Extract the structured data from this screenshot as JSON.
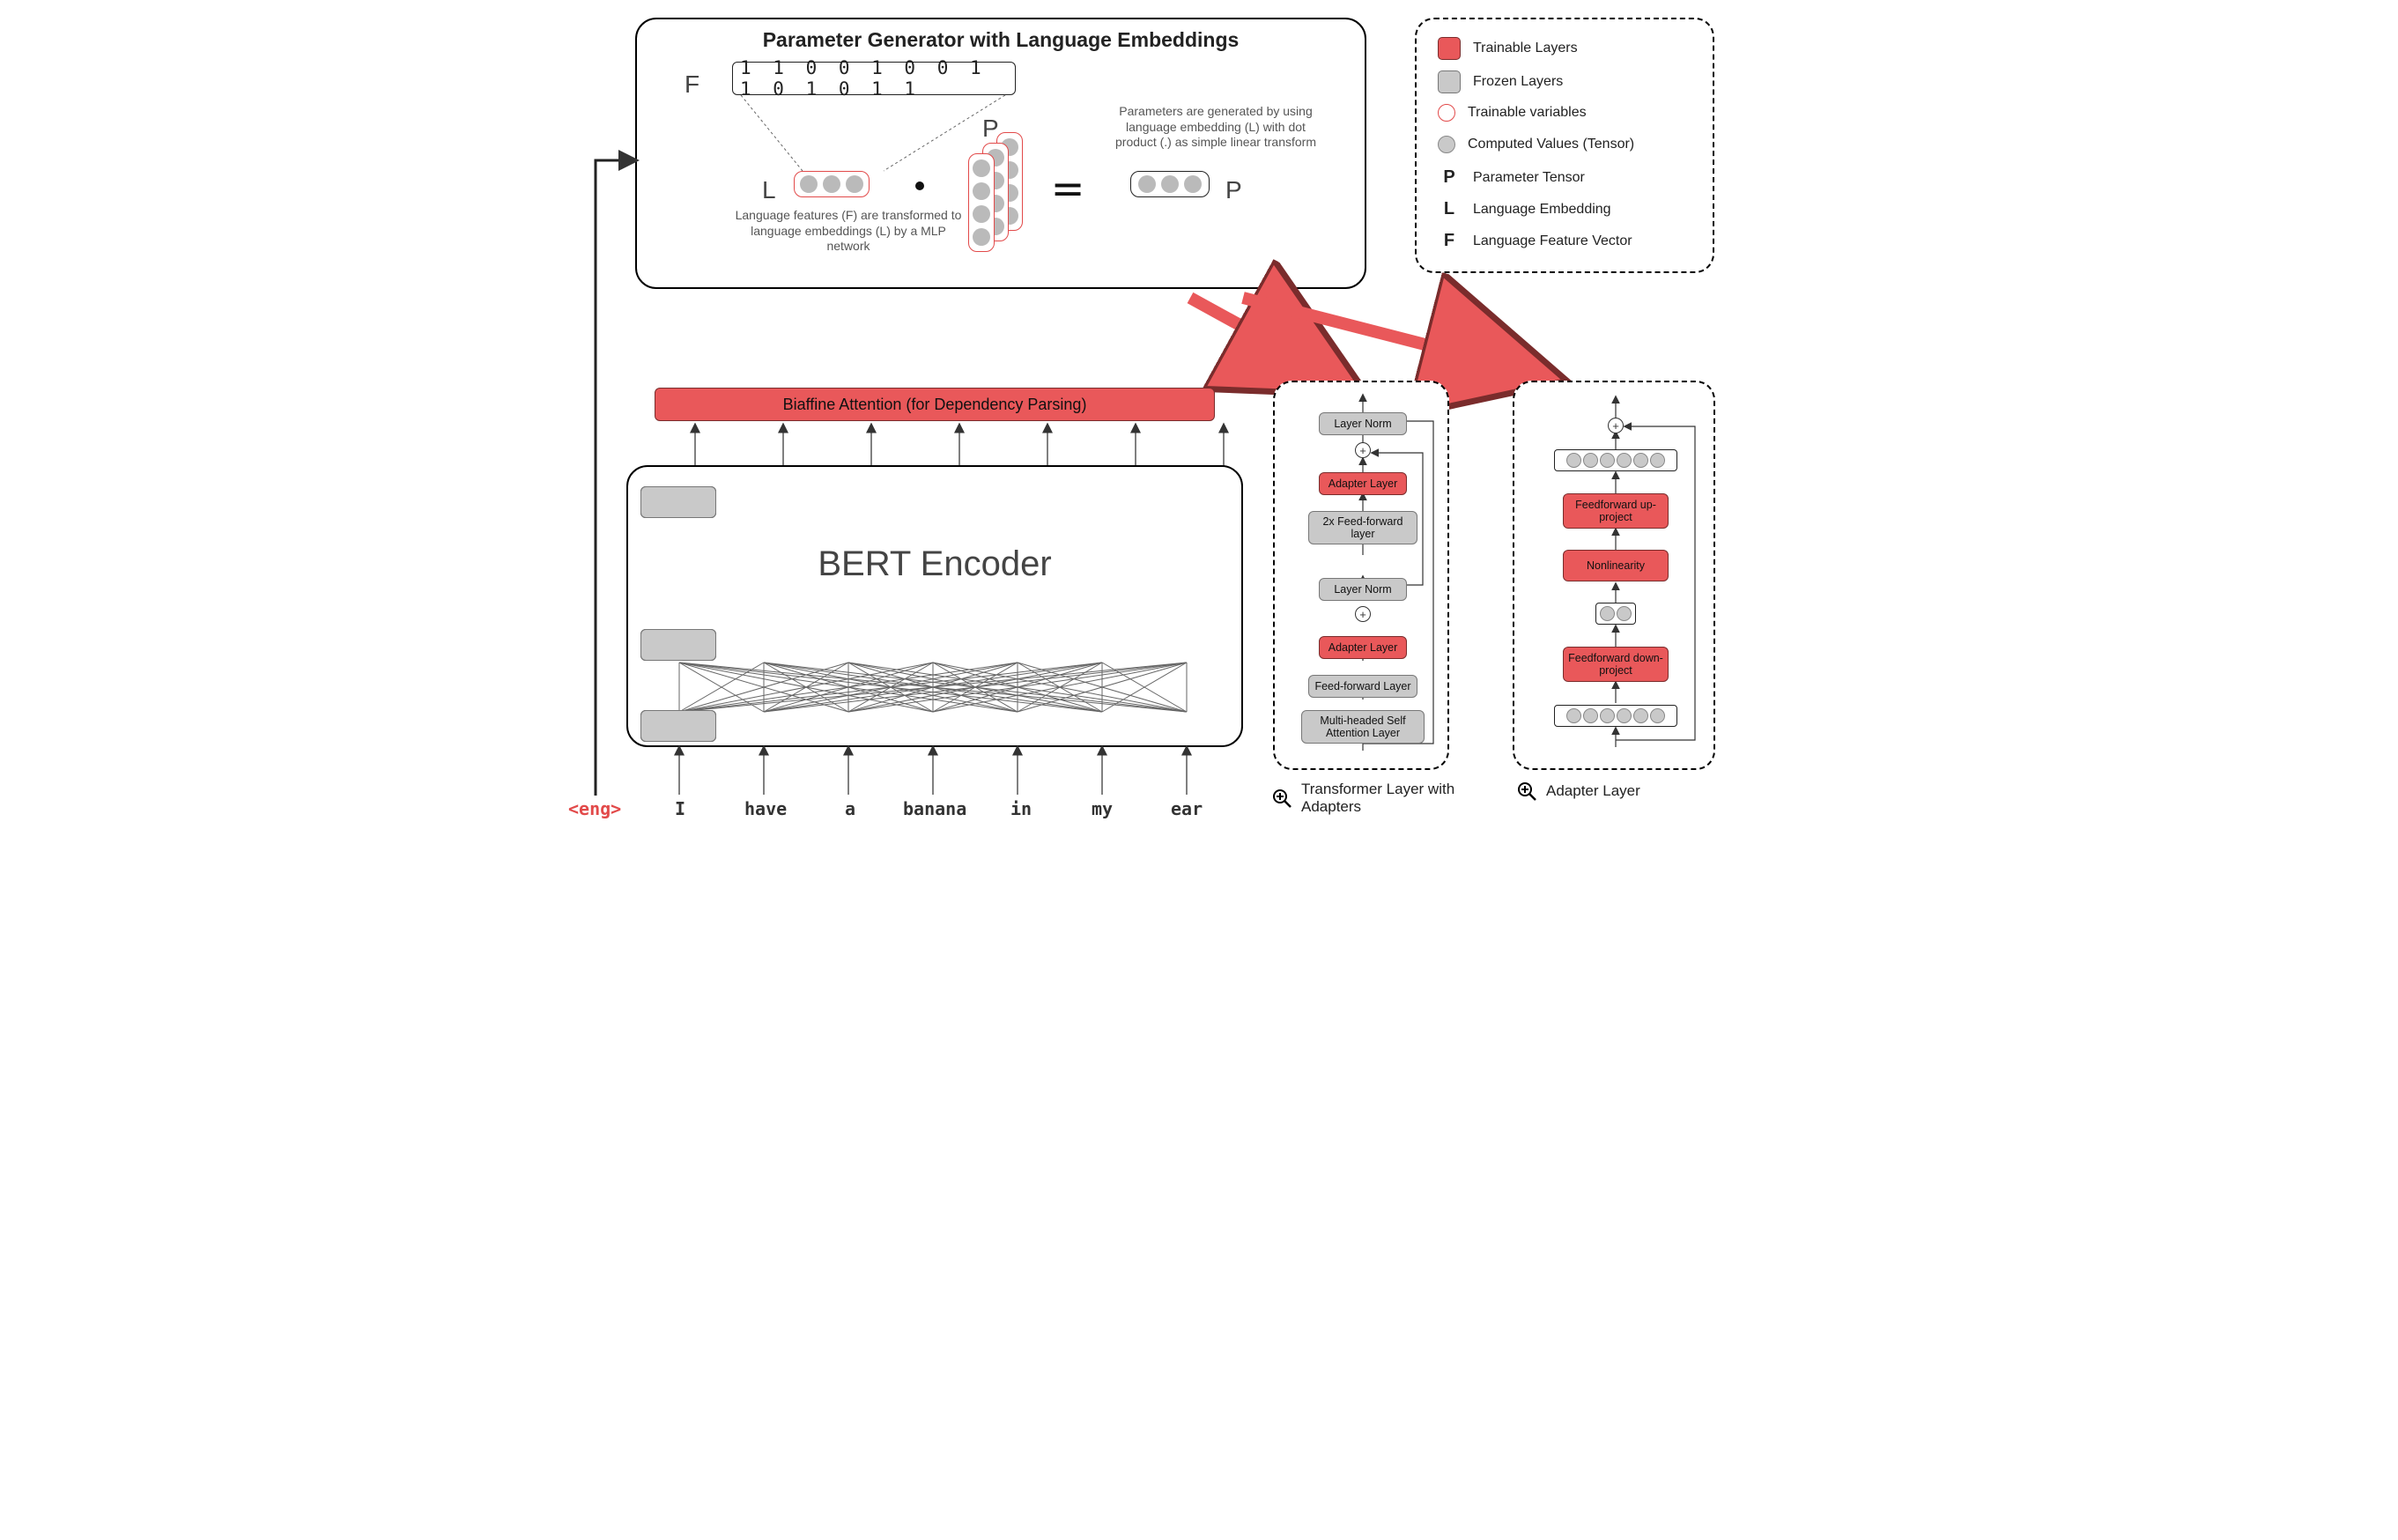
{
  "pg": {
    "title": "Parameter Generator with Language Embeddings",
    "F_label": "F",
    "F_bits": "1 1 0 0 1 0 0 1 1 0 1 0 1 1",
    "L_label": "L",
    "L_caption": "Language features (F) are transformed to language embeddings (L) by a MLP network",
    "P_left_label": "P",
    "P_caption": "Parameters are generated by using language embedding (L) with dot product (.) as simple linear transform",
    "P_right_label": "P"
  },
  "legend": {
    "trainable_layers": "Trainable Layers",
    "frozen_layers": "Frozen Layers",
    "trainable_vars": "Trainable variables",
    "computed_values": "Computed Values (Tensor)",
    "P": "Parameter Tensor",
    "L": "Language Embedding",
    "F": "Language Feature Vector"
  },
  "biaffine": "Biaffine Attention (for Dependency Parsing)",
  "bert_title": "BERT Encoder",
  "tokens": [
    "<eng>",
    "I",
    "have",
    "a",
    "banana",
    "in",
    "my",
    "ear"
  ],
  "tlayer": {
    "title": "Transformer Layer with Adapters",
    "b1": "Layer Norm",
    "b2": "Adapter Layer",
    "b3": "2x Feed-forward layer",
    "b4": "Layer Norm",
    "b5": "Adapter Layer",
    "b6": "Feed-forward Layer",
    "b7": "Multi-headed Self Attention Layer"
  },
  "adapter": {
    "title": "Adapter Layer",
    "b1": "Feedforward up-project",
    "b2": "Nonlinearity",
    "b3": "Feedforward down-project"
  },
  "colors": {
    "red": "#e9585a",
    "gray": "#c9c9c9",
    "red_border": "#e24a4a"
  }
}
